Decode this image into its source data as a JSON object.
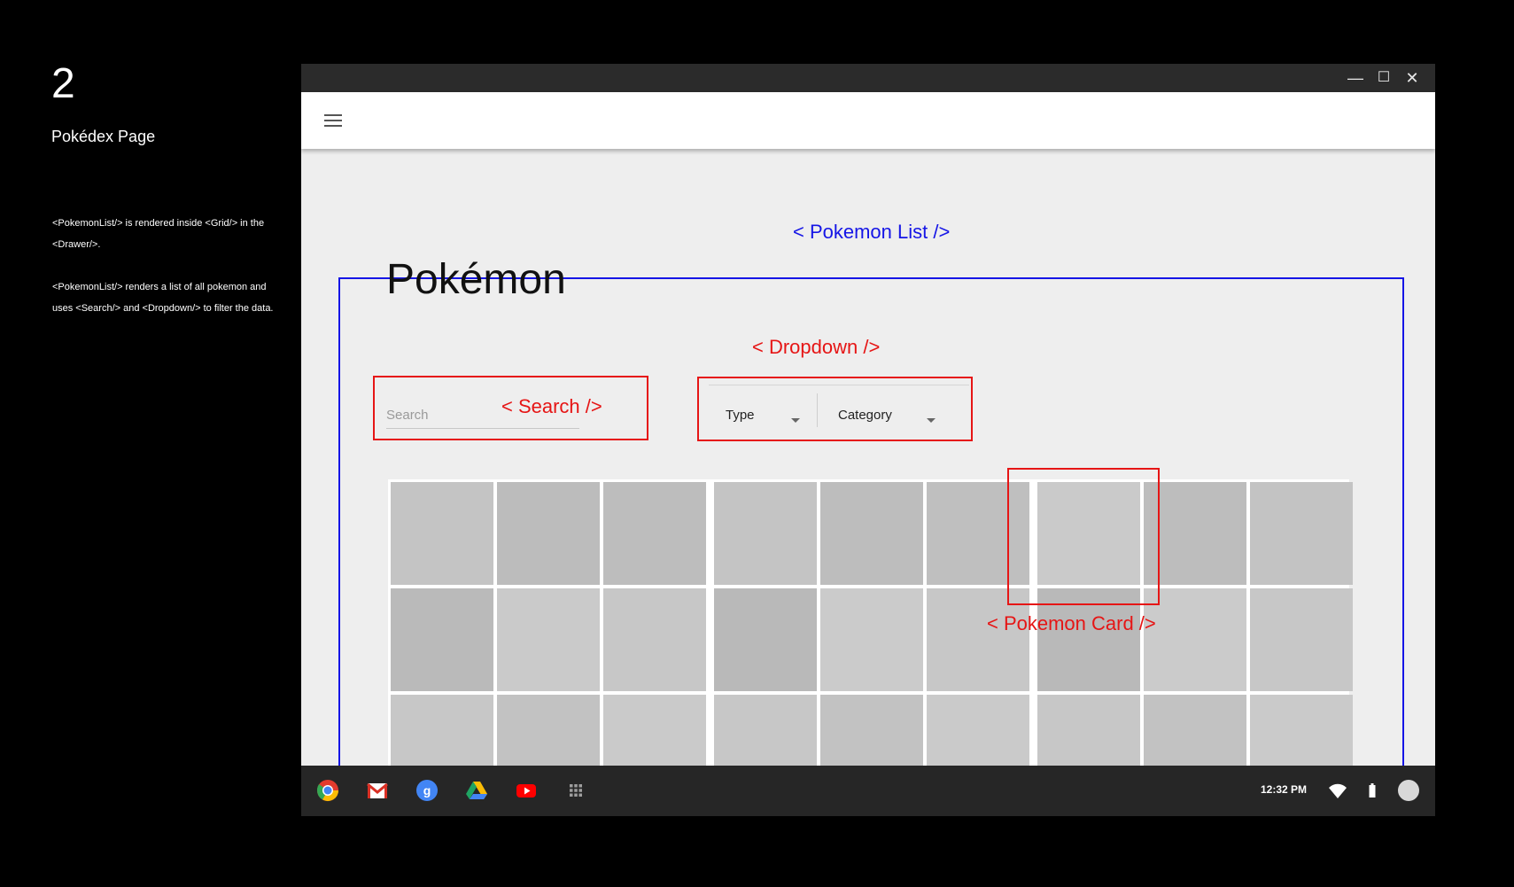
{
  "slide": {
    "number": "2",
    "title": "Pokédex Page",
    "description": [
      "<PokemonList/> is rendered inside <Grid/> in the <Drawer/>.",
      "<PokemonList/> renders a list of all pokemon and uses <Search/> and <Dropdown/> to filter the data."
    ]
  },
  "window": {
    "controls": [
      "minimize-icon",
      "maximize-icon",
      "close-icon"
    ],
    "control_glyphs": [
      "—",
      "☐",
      "✕"
    ]
  },
  "appbar": {
    "menu_icon": "hamburger-menu-icon"
  },
  "annotations": {
    "pokemon_list": "< Pokemon List />",
    "dropdown": "< Dropdown />",
    "search": "< Search />",
    "pokemon_card": "< Pokemon Card />"
  },
  "page": {
    "title": "Pokémon",
    "search_placeholder": "Search",
    "dropdowns": [
      {
        "label": "Type",
        "icon": "caret-down-icon"
      },
      {
        "label": "Category",
        "icon": "caret-down-icon"
      }
    ]
  },
  "grid": {
    "columns": 9,
    "rows": 3,
    "shades": [
      [
        "#c4c4c4",
        "#bcbcbc",
        "#bdbdbd",
        "#c4c4c4",
        "#bdbdbd",
        "#bfbfbf",
        "#cacaca",
        "#bdbdbd",
        "#c3c3c3"
      ],
      [
        "#bababa",
        "#cacaca",
        "#c7c7c7",
        "#b9b9b9",
        "#cbcbcb",
        "#c7c7c7",
        "#b9b9b9",
        "#cbcbcb",
        "#c7c7c7"
      ],
      [
        "#c7c7c7",
        "#c2c2c2",
        "#cacaca",
        "#c7c7c7",
        "#c2c2c2",
        "#cacaca",
        "#c7c7c7",
        "#c2c2c2",
        "#cacaca"
      ]
    ],
    "last_row_torn": true
  },
  "taskbar": {
    "apps": [
      {
        "name": "chrome-icon",
        "color": "#e33b2e"
      },
      {
        "name": "gmail-icon",
        "color": "#d93025"
      },
      {
        "name": "google-plus-icon",
        "color": "#4285f4"
      },
      {
        "name": "drive-icon",
        "color": "#1fa463"
      },
      {
        "name": "youtube-icon",
        "color": "#ff0000"
      },
      {
        "name": "app-launcher-icon",
        "color": "#9e9e9e"
      }
    ],
    "time": "12:32 PM",
    "status_icons": [
      "wifi-icon",
      "battery-icon",
      "account-avatar"
    ]
  }
}
